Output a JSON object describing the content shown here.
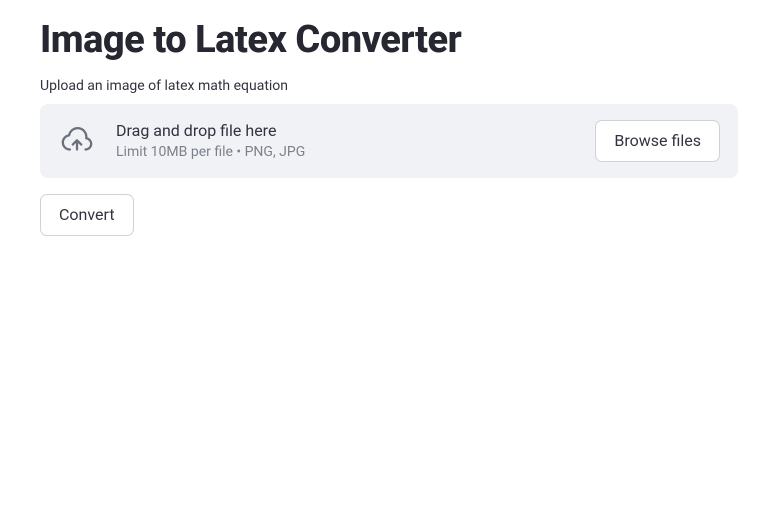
{
  "header": {
    "title": "Image to Latex Converter"
  },
  "uploader": {
    "label": "Upload an image of latex math equation",
    "dropzone_title": "Drag and drop file here",
    "dropzone_hint": "Limit 10MB per file • PNG, JPG",
    "browse_label": "Browse files"
  },
  "actions": {
    "convert_label": "Convert"
  }
}
